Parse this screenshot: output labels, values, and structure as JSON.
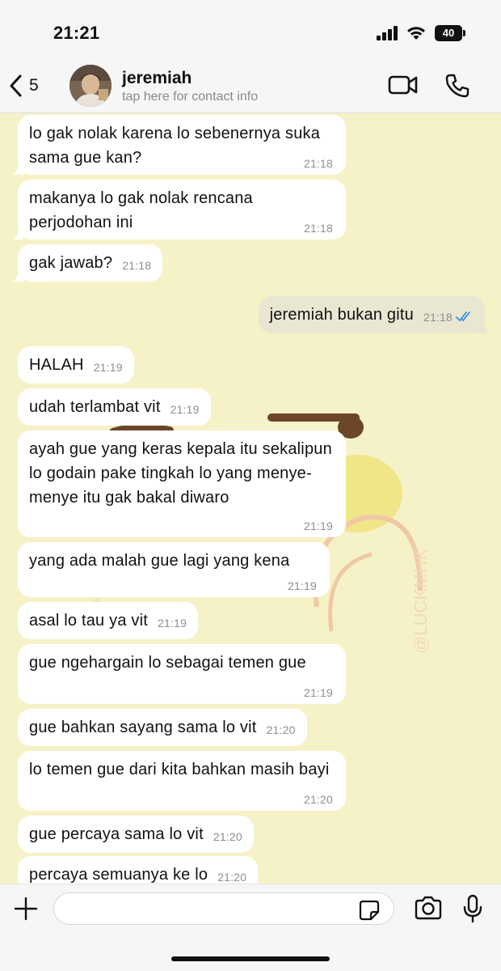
{
  "status_bar": {
    "time": "21:21",
    "battery": "40"
  },
  "header": {
    "back_count": "5",
    "contact_name": "jeremiah",
    "contact_sub": "tap here for contact info",
    "icons": [
      "chevron-left-icon",
      "video-call-icon",
      "phone-icon"
    ]
  },
  "messages": [
    {
      "dir": "in",
      "text": "lo gak nolak karena lo sebenernya suka sama gue kan?",
      "time": "21:18"
    },
    {
      "dir": "in",
      "text": "makanya lo gak nolak rencana perjodohan ini",
      "time": "21:18"
    },
    {
      "dir": "in",
      "text": "gak jawab?",
      "time": "21:18"
    },
    {
      "dir": "out",
      "text": "jeremiah bukan gitu",
      "time": "21:18",
      "status": "read"
    },
    {
      "dir": "in",
      "text": "HALAH",
      "time": "21:19"
    },
    {
      "dir": "in",
      "text": "udah terlambat vit",
      "time": "21:19"
    },
    {
      "dir": "in",
      "text": "ayah gue yang keras kepala itu sekalipun lo godain pake tingkah lo yang menye-menye itu gak bakal diwaro",
      "time": "21:19"
    },
    {
      "dir": "in",
      "text": "yang ada malah gue lagi yang kena",
      "time": "21:19"
    },
    {
      "dir": "in",
      "text": "asal lo tau ya vit",
      "time": "21:19"
    },
    {
      "dir": "in",
      "text": "gue ngehargain lo sebagai temen gue",
      "time": "21:19"
    },
    {
      "dir": "in",
      "text": "gue bahkan sayang sama lo vit",
      "time": "21:20"
    },
    {
      "dir": "in",
      "text": "lo temen gue dari kita bahkan masih bayi",
      "time": "21:20"
    },
    {
      "dir": "in",
      "text": "gue percaya sama lo vit",
      "time": "21:20"
    },
    {
      "dir": "in",
      "text": "percaya semuanya ke lo",
      "time": "21:20"
    }
  ],
  "wallpaper_watermark": "@LUCKMHK",
  "input": {
    "placeholder": ""
  },
  "colors": {
    "wallpaper": "#f6f2c8",
    "incoming_bubble": "#ffffff",
    "outgoing_bubble": "#e9e6d2",
    "read_ticks": "#3b8fe8",
    "timestamp": "#8e8e8e"
  }
}
